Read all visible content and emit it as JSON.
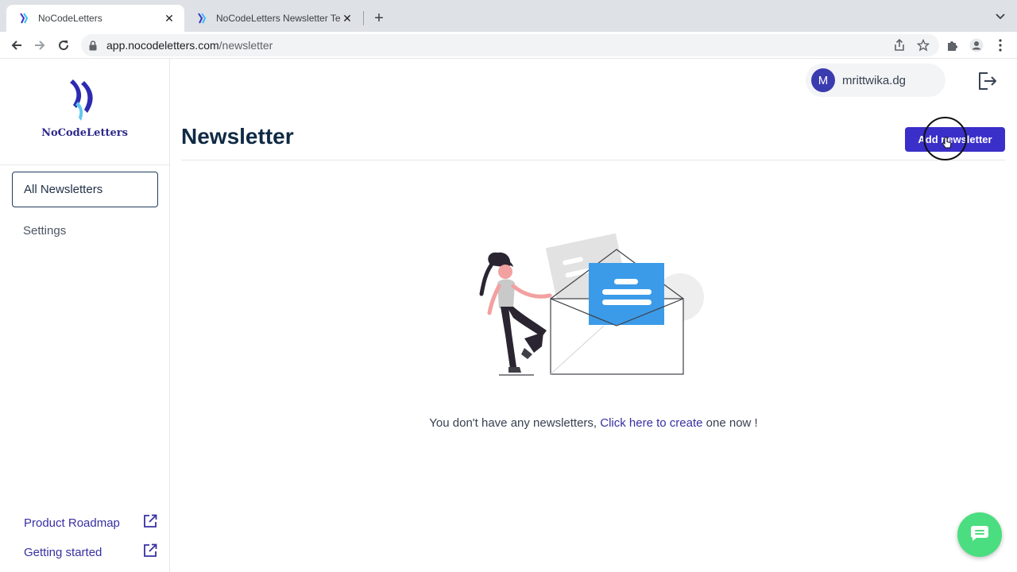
{
  "browser": {
    "tabs": [
      {
        "title": "NoCodeLetters",
        "active": true
      },
      {
        "title": "NoCodeLetters Newsletter Ten",
        "active": false
      }
    ],
    "url_host": "app.nocodeletters.com",
    "url_path": "/newsletter"
  },
  "sidebar": {
    "logo_text": "NoCodeLetters",
    "items": [
      {
        "label": "All Newsletters",
        "active": true
      },
      {
        "label": "Settings",
        "active": false
      }
    ],
    "links": [
      {
        "label": "Product Roadmap"
      },
      {
        "label": "Getting started"
      }
    ]
  },
  "header": {
    "avatar_initial": "M",
    "username": "mrittwika.dg"
  },
  "main": {
    "title": "Newsletter",
    "add_button": "Add newsletter",
    "empty_prefix": "You don't have any newsletters, ",
    "empty_link": "Click here to create",
    "empty_suffix": " one now !"
  },
  "colors": {
    "brand": "#3b2fc9",
    "link": "#3730a3",
    "title": "#0f2a44",
    "chat": "#4ade80",
    "envelope_blue": "#3b9be8"
  }
}
